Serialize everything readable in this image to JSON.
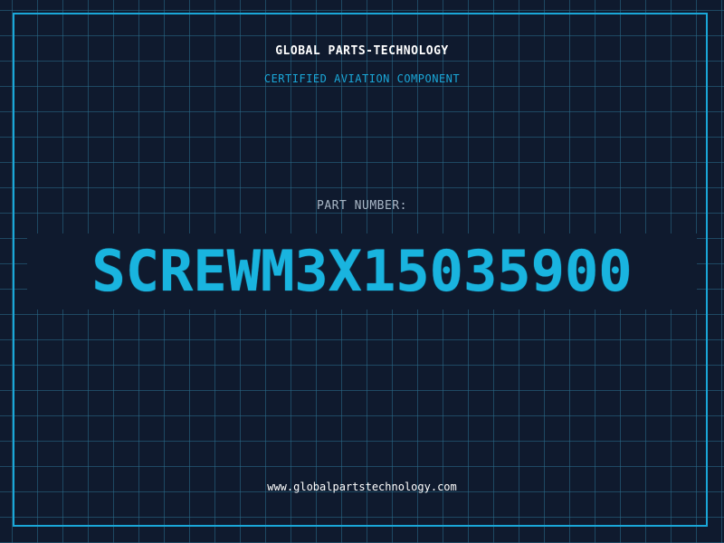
{
  "card": {
    "company": "GLOBAL PARTS-TECHNOLOGY",
    "subtitle": "CERTIFIED AVIATION COMPONENT",
    "part_label": "PART NUMBER:",
    "part_number": "SCREWM3X15035900",
    "website": "www.globalpartstechnology.com"
  },
  "colors": {
    "background": "#0f1a2e",
    "accent": "#1aa7d8",
    "grid": "#2a6e8c",
    "part_number": "#19b4df"
  }
}
